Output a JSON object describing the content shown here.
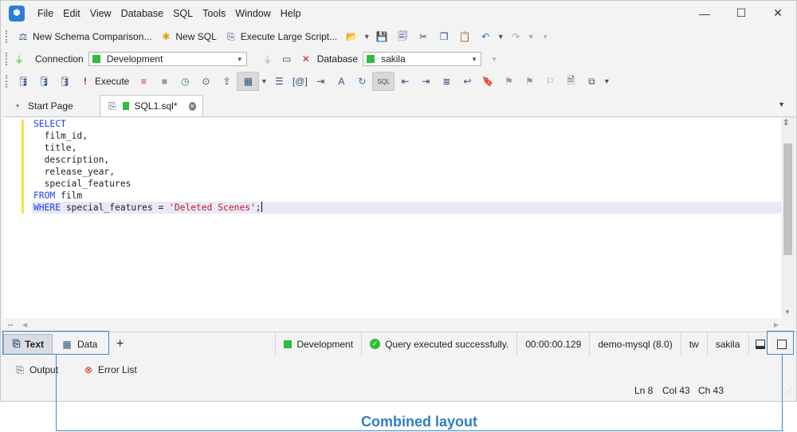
{
  "menu": [
    "File",
    "Edit",
    "View",
    "Database",
    "SQL",
    "Tools",
    "Window",
    "Help"
  ],
  "toolbar1": {
    "new_schema_comparison": "New Schema Comparison...",
    "new_sql": "New SQL",
    "execute_large_script": "Execute Large Script..."
  },
  "toolbar2": {
    "connection_label": "Connection",
    "connection_value": "Development",
    "database_label": "Database",
    "database_value": "sakila"
  },
  "toolbar3": {
    "execute_label": "Execute"
  },
  "tabs": {
    "start_page": "Start Page",
    "sql_tab": "SQL1.sql*"
  },
  "editor": {
    "lines": [
      {
        "kw": "SELECT",
        "rest": ""
      },
      {
        "kw": "",
        "rest": "  film_id,"
      },
      {
        "kw": "",
        "rest": "  title,"
      },
      {
        "kw": "",
        "rest": "  description,"
      },
      {
        "kw": "",
        "rest": "  release_year,"
      },
      {
        "kw": "",
        "rest": "  special_features"
      },
      {
        "kw": "FROM",
        "rest": " film"
      },
      {
        "kw": "WHERE",
        "rest": " special_features = ",
        "str": "'Deleted Scenes'",
        "tail": ";"
      }
    ]
  },
  "statusbar": {
    "text_tab": "Text",
    "data_tab": "Data",
    "connection": "Development",
    "message": "Query executed successfully.",
    "elapsed": "00:00:00.129",
    "server": "demo-mysql (8.0)",
    "user": "tw",
    "database": "sakila"
  },
  "output_bar": {
    "output": "Output",
    "error_list": "Error List"
  },
  "position": {
    "ln": "Ln 8",
    "col": "Col 43",
    "ch": "Ch 43"
  },
  "callout": {
    "label": "Combined layout"
  },
  "colors": {
    "accent": "#2f7dc4",
    "connection_green": "#2ebd3a",
    "keyword": "#1a3cf0",
    "string": "#c21d1d"
  }
}
